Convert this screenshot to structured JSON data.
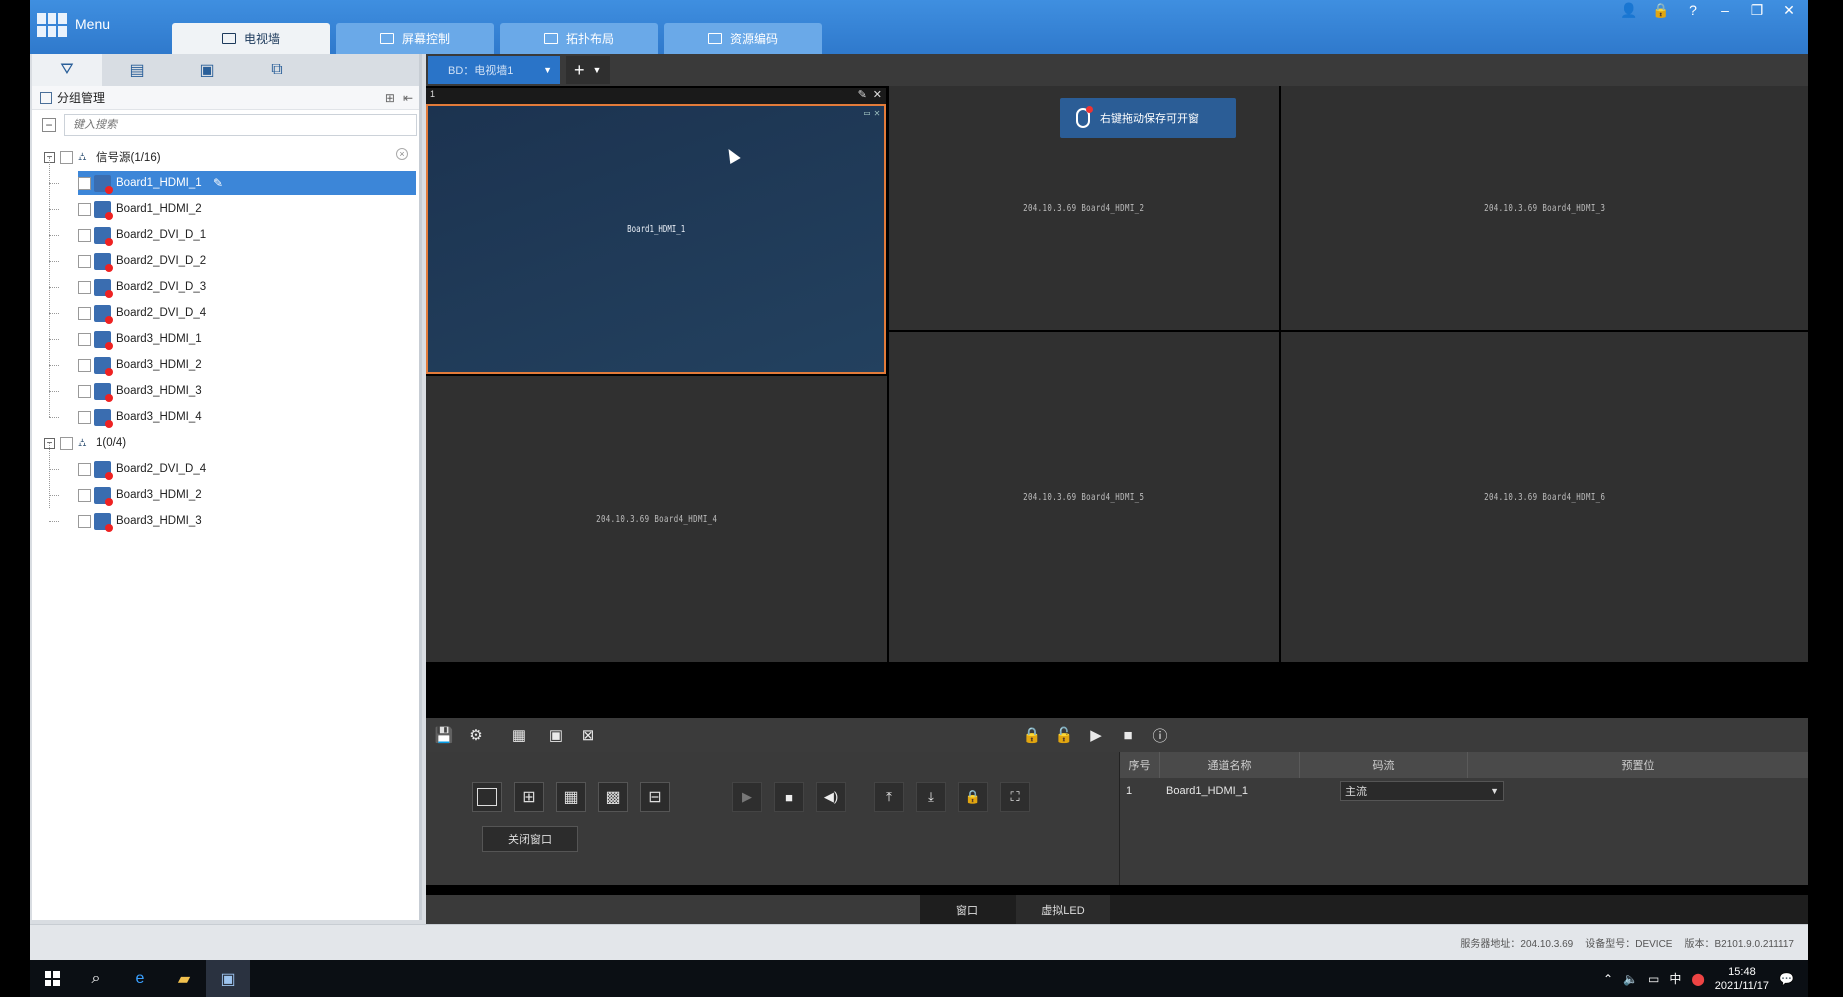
{
  "window": {
    "menu_label": "Menu",
    "tabs": [
      {
        "label": "电视墙",
        "active": true
      },
      {
        "label": "屏幕控制",
        "active": false
      },
      {
        "label": "拓扑布局",
        "active": false
      },
      {
        "label": "资源编码",
        "active": false
      }
    ],
    "controls": {
      "user": "👤",
      "lock": "🔒",
      "help": "?",
      "minimize": "–",
      "restore": "❐",
      "close": "✕"
    }
  },
  "left_panel": {
    "header_title": "分组管理",
    "search_placeholder": "键入搜索",
    "groups": [
      {
        "label": "信号源(1/16)",
        "items": [
          "Board1_HDMI_1",
          "Board1_HDMI_2",
          "Board2_DVI_D_1",
          "Board2_DVI_D_2",
          "Board2_DVI_D_3",
          "Board2_DVI_D_4",
          "Board3_HDMI_1",
          "Board3_HDMI_2",
          "Board3_HDMI_3",
          "Board3_HDMI_4"
        ]
      },
      {
        "label": "1(0/4)",
        "items": [
          "Board2_DVI_D_4",
          "Board3_HDMI_2",
          "Board3_HDMI_3"
        ]
      }
    ],
    "selected_item": "Board1_HDMI_1"
  },
  "wall": {
    "tab_label": "BD：电视墙1",
    "window_number": "1",
    "window_source": "Board1_HDMI_1",
    "hint": "右键拖动保存可开窗",
    "cells": [
      "204.10.3.69 Board4_HDMI_2",
      "204.10.3.69 Board4_HDMI_3",
      "204.10.3.69 Board4_HDMI_4",
      "204.10.3.69 Board4_HDMI_5",
      "204.10.3.69 Board4_HDMI_6"
    ]
  },
  "controls": {
    "close_window_label": "关闭窗口"
  },
  "table": {
    "headers": [
      "序号",
      "通道名称",
      "码流",
      "预置位"
    ],
    "rows": [
      {
        "index": "1",
        "channel": "Board1_HDMI_1",
        "stream": "主流"
      }
    ]
  },
  "bottom_tabs": [
    "窗口",
    "虚拟LED"
  ],
  "status": {
    "server": "服务器地址：204.10.3.69",
    "device": "设备型号：DEVICE",
    "version": "版本：B2101.9.0.211117"
  },
  "taskbar": {
    "time": "15:48",
    "date": "2021/11/17",
    "ime": "中"
  },
  "colors": {
    "accent": "#2f79cc",
    "selection": "#3c86d8",
    "active_window_border": "#e27b3a"
  }
}
